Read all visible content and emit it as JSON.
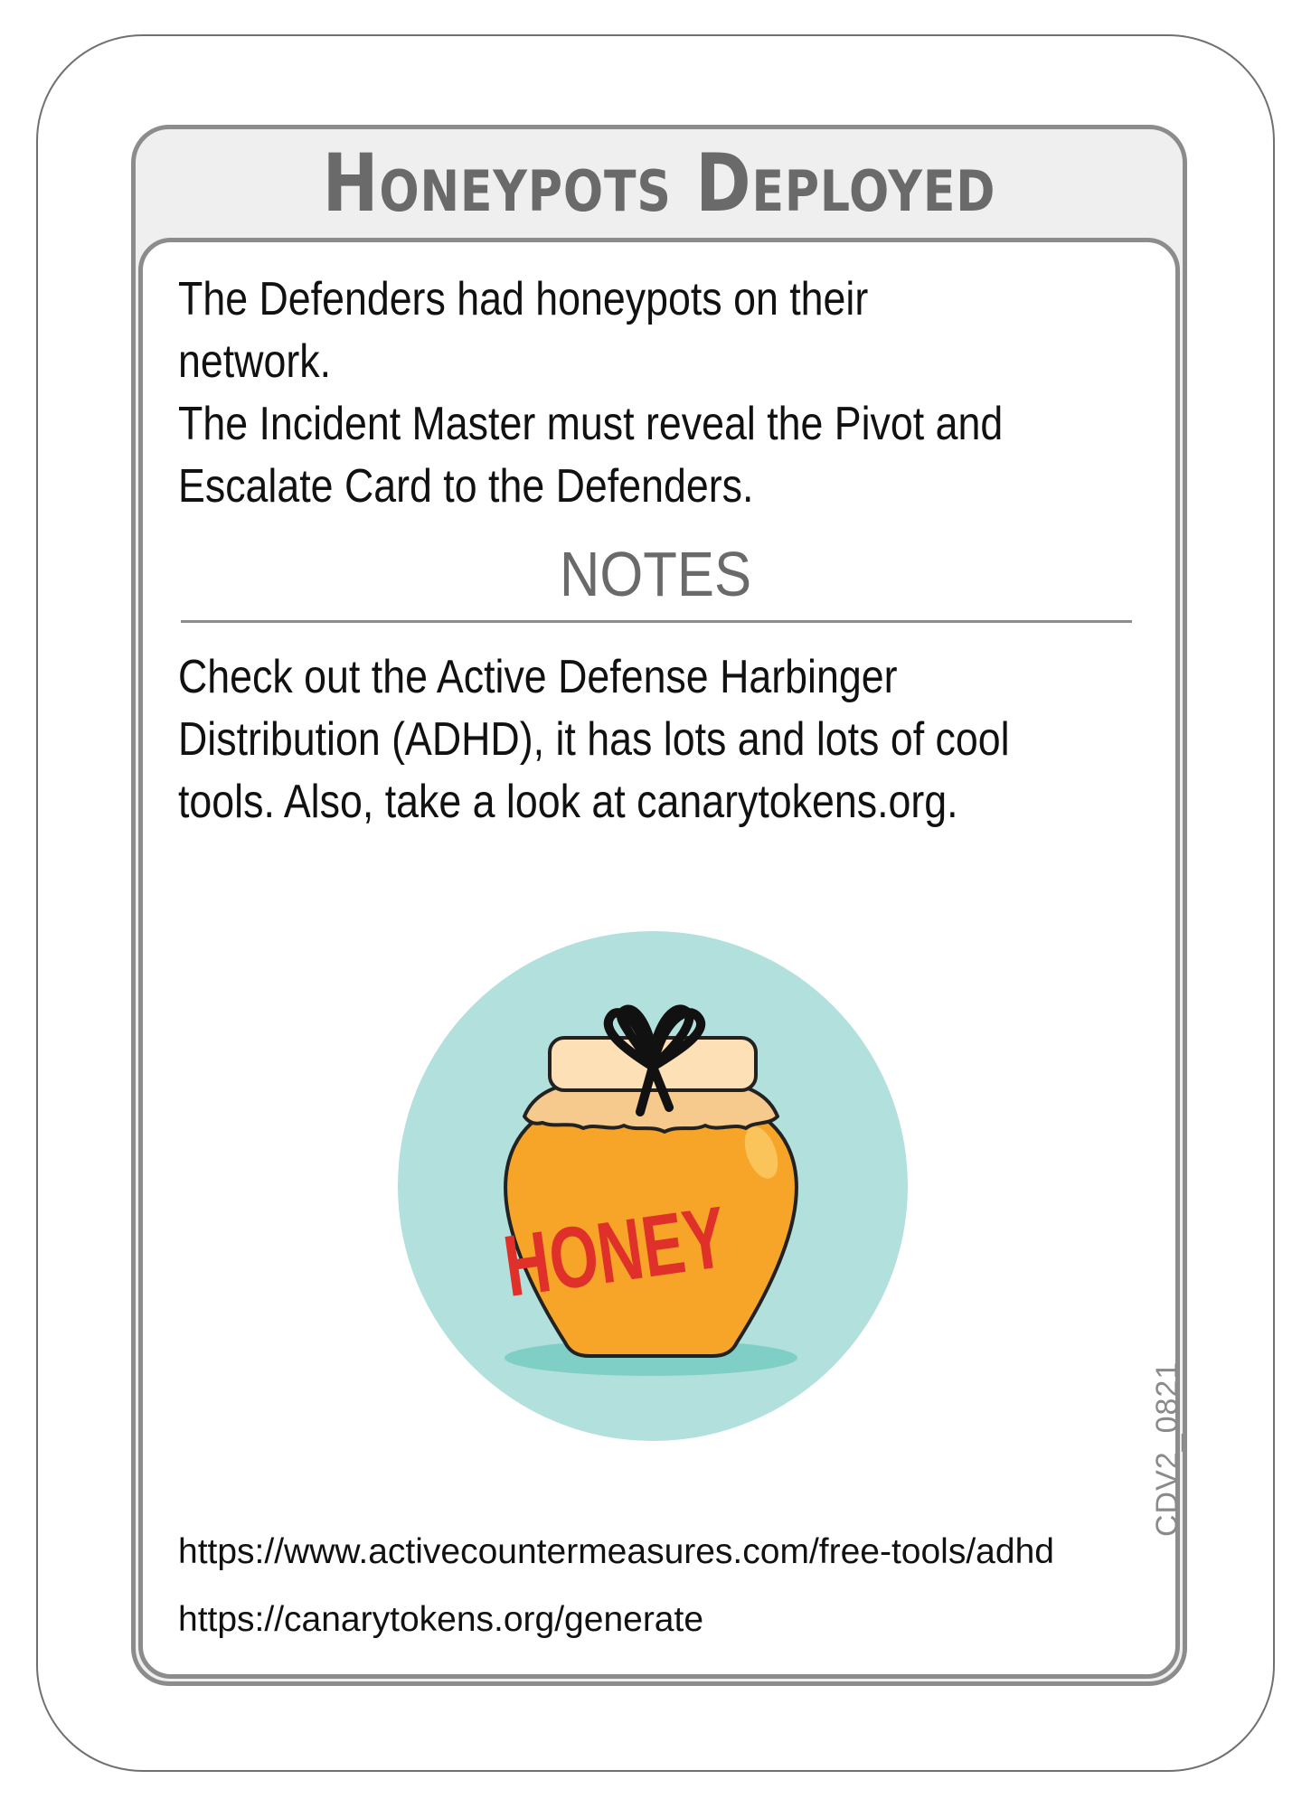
{
  "card": {
    "title": "Honeypots Deployed",
    "description": "The Defenders had honeypots on their network.\nThe Incident Master must reveal the Pivot and\nEscalate Card to the Defenders.",
    "notes_heading": "NOTES",
    "notes_text": "Check out the Active Defense Harbinger\nDistribution (ADHD), it has lots and lots of cool\ntools. Also, take a look at canarytokens.org.",
    "illustration": {
      "icon": "honey-jar-icon",
      "jar_label": "HONEY",
      "colors": {
        "circle": "#b2e0dc",
        "jar": "#f7a528",
        "lid": "#fde0b6",
        "label_text": "#e0302a",
        "shadow": "#7fcfc6"
      }
    },
    "links": [
      "https://www.activecountermeasures.com/free-tools/adhd",
      "https://canarytokens.org/generate"
    ],
    "code": "CDV2_0821"
  }
}
